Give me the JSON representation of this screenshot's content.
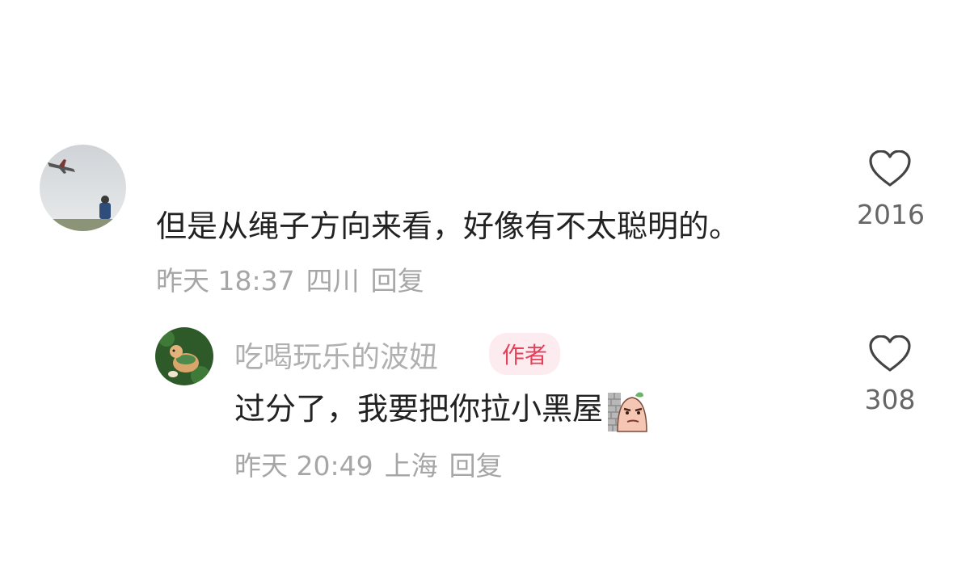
{
  "comments": [
    {
      "avatar_icon": "plane-avatar-icon",
      "text": "但是从绳子方向来看，好像有不太聪明的。",
      "time": "昨天 18:37",
      "location": "四川",
      "reply_label": "回复",
      "like_count": "2016"
    }
  ],
  "reply": {
    "avatar_icon": "corgi-avatar-icon",
    "username": "吃喝玩乐的波妞",
    "badge": "作者",
    "text": "过分了，我要把你拉小黑屋",
    "sticker_icon": "dark-room-sticker-icon",
    "time": "昨天 20:49",
    "location": "上海",
    "reply_label": "回复",
    "like_count": "308"
  },
  "colors": {
    "badge_bg": "#fdecef",
    "badge_text": "#e63f5a",
    "meta_text": "#a6a6a6"
  }
}
